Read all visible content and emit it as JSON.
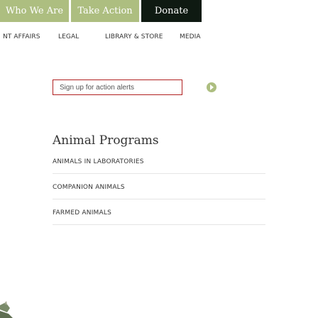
{
  "top_nav": {
    "items": [
      "Who We Are",
      "Take Action",
      "Donate"
    ]
  },
  "sub_nav": {
    "items": [
      "NT AFFAIRS",
      "LEGAL",
      "LIBRARY & STORE",
      "MEDIA"
    ]
  },
  "alerts": {
    "label": "Sign up for action alerts"
  },
  "programs": {
    "title": "Animal Programs",
    "items": [
      "ANIMALS IN LABORATORIES",
      "COMPANION ANIMALS",
      "FARMED ANIMALS"
    ]
  },
  "colors": {
    "nav_green": "#adbe80",
    "nav_dark": "#0f1a12",
    "alert_border": "#b11f1f"
  }
}
